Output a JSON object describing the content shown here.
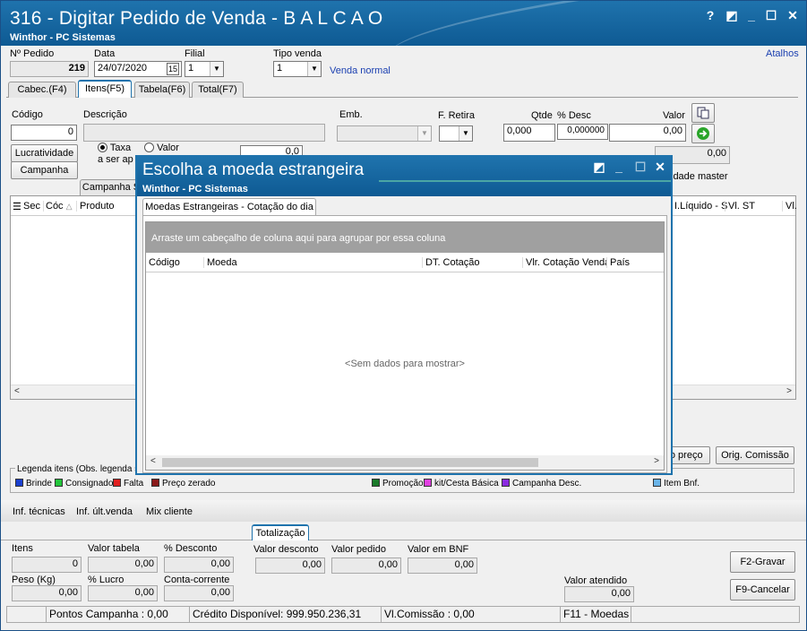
{
  "window": {
    "title": "316 - Digitar Pedido de Venda - B A L C A O",
    "subtitle": "Winthor - PC Sistemas",
    "buttons": {
      "help": "?",
      "restore": "◩",
      "minimize": "_",
      "maximize": "☐",
      "close": "✕"
    }
  },
  "header": {
    "atalhos": "Atalhos",
    "pedido_label": "Nº Pedido",
    "pedido_value": "219",
    "data_label": "Data",
    "data_value": "24/07/2020",
    "cal_icon": "15",
    "filial_label": "Filial",
    "filial_value": "1",
    "tipo_venda_label": "Tipo venda",
    "tipo_venda_value": "1",
    "tipo_venda_desc": "Venda normal"
  },
  "tabs": [
    "Cabec.(F4)",
    "Itens(F5)",
    "Tabela(F6)",
    "Total(F7)"
  ],
  "itens": {
    "codigo_label": "Código",
    "codigo_value": "0",
    "descricao_label": "Descrição",
    "emb_label": "Emb.",
    "fretira_label": "F. Retira",
    "qtde_label": "Qtde",
    "qtde_value": "0,000",
    "desc_label": "% Desc",
    "desc_value": "0,000000",
    "valor_label": "Valor",
    "valor_value": "0,00",
    "lucratividade": "Lucratividade",
    "campanha": "Campanha",
    "taxa": "Taxa",
    "valor_radio": "Valor",
    "a_ser_ap": "a ser ap",
    "small_value": "0,0",
    "extra_value": "0,00",
    "unidade_master": "idade master",
    "campanha_tab": "Campanha S",
    "grid_cols_left": [
      "Sec",
      "Cóc",
      "Produto"
    ],
    "grid_cols_right": [
      "I.Líquido - S",
      "Vl. ST",
      "Vl."
    ],
    "btn_preco": "lo preço",
    "btn_orig_comissao": "Orig. Comissão"
  },
  "legend": {
    "title": "Legenda itens (Obs. legenda sul",
    "items": [
      {
        "label": "Brinde",
        "color": "#1a3fcf"
      },
      {
        "label": "Consignado",
        "color": "#22c53a"
      },
      {
        "label": "Falta",
        "color": "#e02020"
      },
      {
        "label": "Preço zerado",
        "color": "#8a1a1a"
      },
      {
        "label": "Promoção",
        "color": "#1a7a2a"
      },
      {
        "label": "kit/Cesta Básica",
        "color": "#e040e0"
      },
      {
        "label": "Campanha Desc.",
        "color": "#8a2ae0"
      },
      {
        "label": "Item Bnf.",
        "color": "#6ab4e8"
      }
    ]
  },
  "bottom_links": [
    "Inf. técnicas",
    "Inf. últ.venda",
    "Mix cliente"
  ],
  "totalizacao": {
    "tab": "Totalização",
    "itens_label": "Itens",
    "itens_value": "0",
    "valor_tabela_label": "Valor tabela",
    "valor_tabela_value": "0,00",
    "pct_desconto_label": "% Desconto",
    "pct_desconto_value": "0,00",
    "valor_desconto_label": "Valor desconto",
    "valor_desconto_value": "0,00",
    "valor_pedido_label": "Valor pedido",
    "valor_pedido_value": "0,00",
    "valor_bnf_label": "Valor em BNF",
    "valor_bnf_value": "0,00",
    "peso_label": "Peso (Kg)",
    "peso_value": "0,00",
    "lucro_label": "% Lucro",
    "lucro_value": "0,00",
    "cc_label": "Conta-corrente",
    "cc_value": "0,00",
    "valor_atendido_label": "Valor atendido",
    "valor_atendido_value": "0,00",
    "gravar": "F2-Gravar",
    "cancelar": "F9-Cancelar"
  },
  "status": {
    "pontos": "Pontos Campanha : 0,00",
    "credito": "Crédito Disponível: 999.950.236,31",
    "comissao": "Vl.Comissão : 0,00",
    "moedas": "F11 - Moedas"
  },
  "modal": {
    "title": "Escolha a moeda estrangeira",
    "subtitle": "Winthor - PC Sistemas",
    "tab": "Moedas Estrangeiras - Cotação do dia",
    "group_hint": "Arraste um cabeçalho de coluna aqui para agrupar por essa coluna",
    "columns": [
      "Código",
      "Moeda",
      "DT. Cotação",
      "Vlr. Cotação Venda",
      "País"
    ],
    "empty": "<Sem dados para mostrar>"
  },
  "colors": {
    "titlebar": "#1f73ad",
    "accent_link": "#1a3fb0"
  }
}
